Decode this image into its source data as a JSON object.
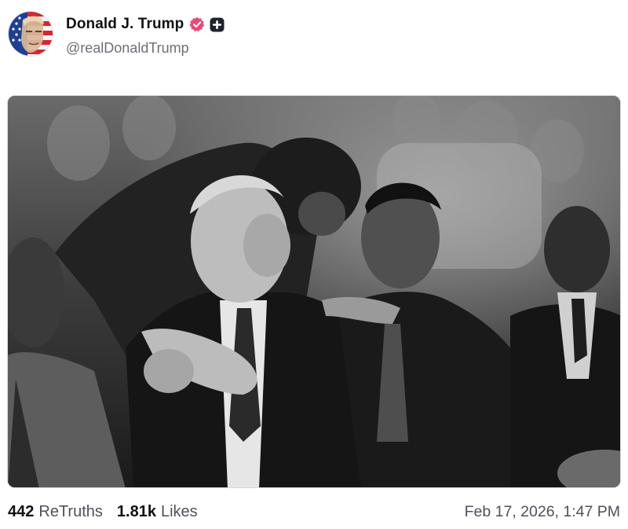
{
  "author": {
    "display_name": "Donald J. Trump",
    "handle": "@realDonaldTrump",
    "avatar_icon": "flag-portrait-avatar",
    "verified_icon": "verified-badge-icon",
    "verified_color": "#e84a7a",
    "plus_icon": "plus-badge-icon"
  },
  "media": {
    "type": "black-and-white-photo",
    "icon": "photo"
  },
  "stats": {
    "retruths_count": "442",
    "retruths_label": "ReTruths",
    "likes_count": "1.81k",
    "likes_label": "Likes"
  },
  "timestamp": "Feb 17, 2026, 1:47 PM"
}
